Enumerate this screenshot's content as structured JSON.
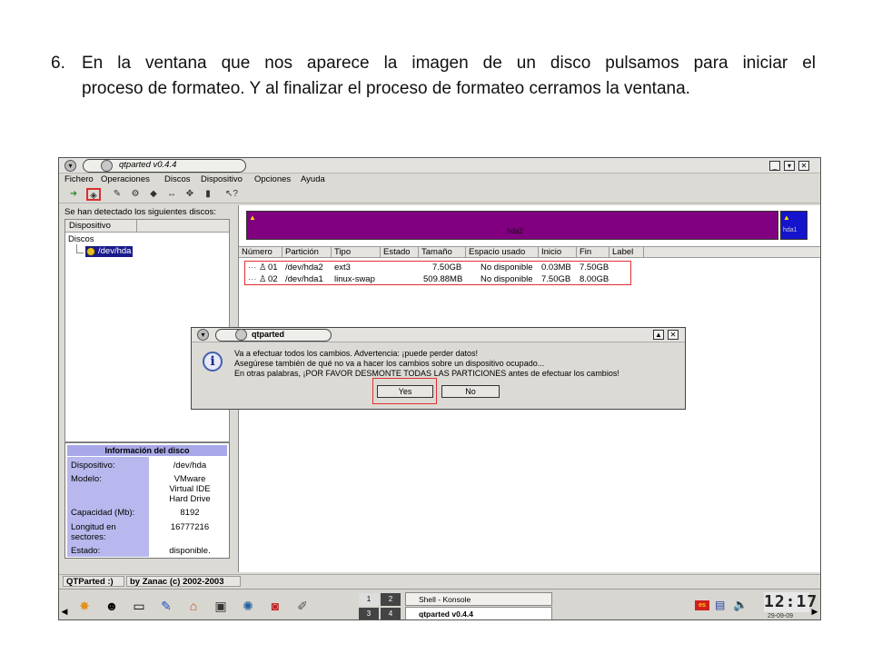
{
  "instruction": {
    "number": "6.",
    "line1": "En la ventana que nos aparece la imagen de un disco pulsamos para iniciar el",
    "line2": "proceso de formateo. Y al finalizar el proceso de formateo cerramos la ventana."
  },
  "window": {
    "title": "qtparted v0.4.4",
    "menu": [
      "Fichero",
      "Operaciones",
      "Discos",
      "Dispositivo",
      "Opciones",
      "Ayuda"
    ]
  },
  "left_panel": {
    "label": "Se han detectado los siguientes discos:",
    "tree_header": "Dispositivo",
    "tree_root": "Discos",
    "tree_node": "/dev/hda"
  },
  "disk_info": {
    "title": "Información del disco",
    "rows": [
      {
        "label": "Dispositivo:",
        "value": "/dev/hda"
      },
      {
        "label": "Modelo:",
        "value": "VMware Virtual IDE Hard Drive"
      },
      {
        "label": "Capacidad (Mb):",
        "value": "8192"
      },
      {
        "label": "Longitud en sectores:",
        "value": "16777216"
      },
      {
        "label": "Estado:",
        "value": "disponible."
      }
    ]
  },
  "partition_map": {
    "main_label": "hda2",
    "swap_label": "hda1"
  },
  "table": {
    "columns": [
      "Número",
      "Partición",
      "Tipo",
      "Estado",
      "Tamaño",
      "Espacio usado",
      "Inicio",
      "Fin",
      "Label"
    ],
    "rows": [
      {
        "num": "01",
        "part": "/dev/hda2",
        "type": "ext3",
        "state": "",
        "size": "7.50GB",
        "used": "No disponible",
        "start": "0.03MB",
        "end": "7.50GB",
        "label": ""
      },
      {
        "num": "02",
        "part": "/dev/hda1",
        "type": "linux-swap",
        "state": "",
        "size": "509.88MB",
        "used": "No disponible",
        "start": "7.50GB",
        "end": "8.00GB",
        "label": ""
      }
    ]
  },
  "dialog": {
    "title": "qtparted",
    "lines": [
      "Va a efectuar todos los cambios. Advertencia: ¡puede perder datos!",
      "Asegúrese también de qué no va a hacer los cambios sobre un dispositivo ocupado...",
      "En otras palabras, ¡POR FAVOR DESMONTE TODAS LAS PARTICIONES antes de efectuar los cambios!"
    ],
    "yes_label": "Yes",
    "no_label": "No"
  },
  "statusbar": {
    "left": "QTParted :)",
    "right": "by Zanac (c) 2002-2003"
  },
  "taskbar": {
    "pager": [
      "1",
      "2",
      "3",
      "4"
    ],
    "tasks": [
      "Shell - Konsole",
      "qtparted v0.4.4"
    ],
    "clock": "12:17",
    "date": "29-09-09",
    "lang": "es"
  },
  "colors": {
    "partition_ext3": "#800080",
    "partition_swap": "#1414cc",
    "highlight": "#e03030",
    "selection": "#1a1a8c"
  }
}
